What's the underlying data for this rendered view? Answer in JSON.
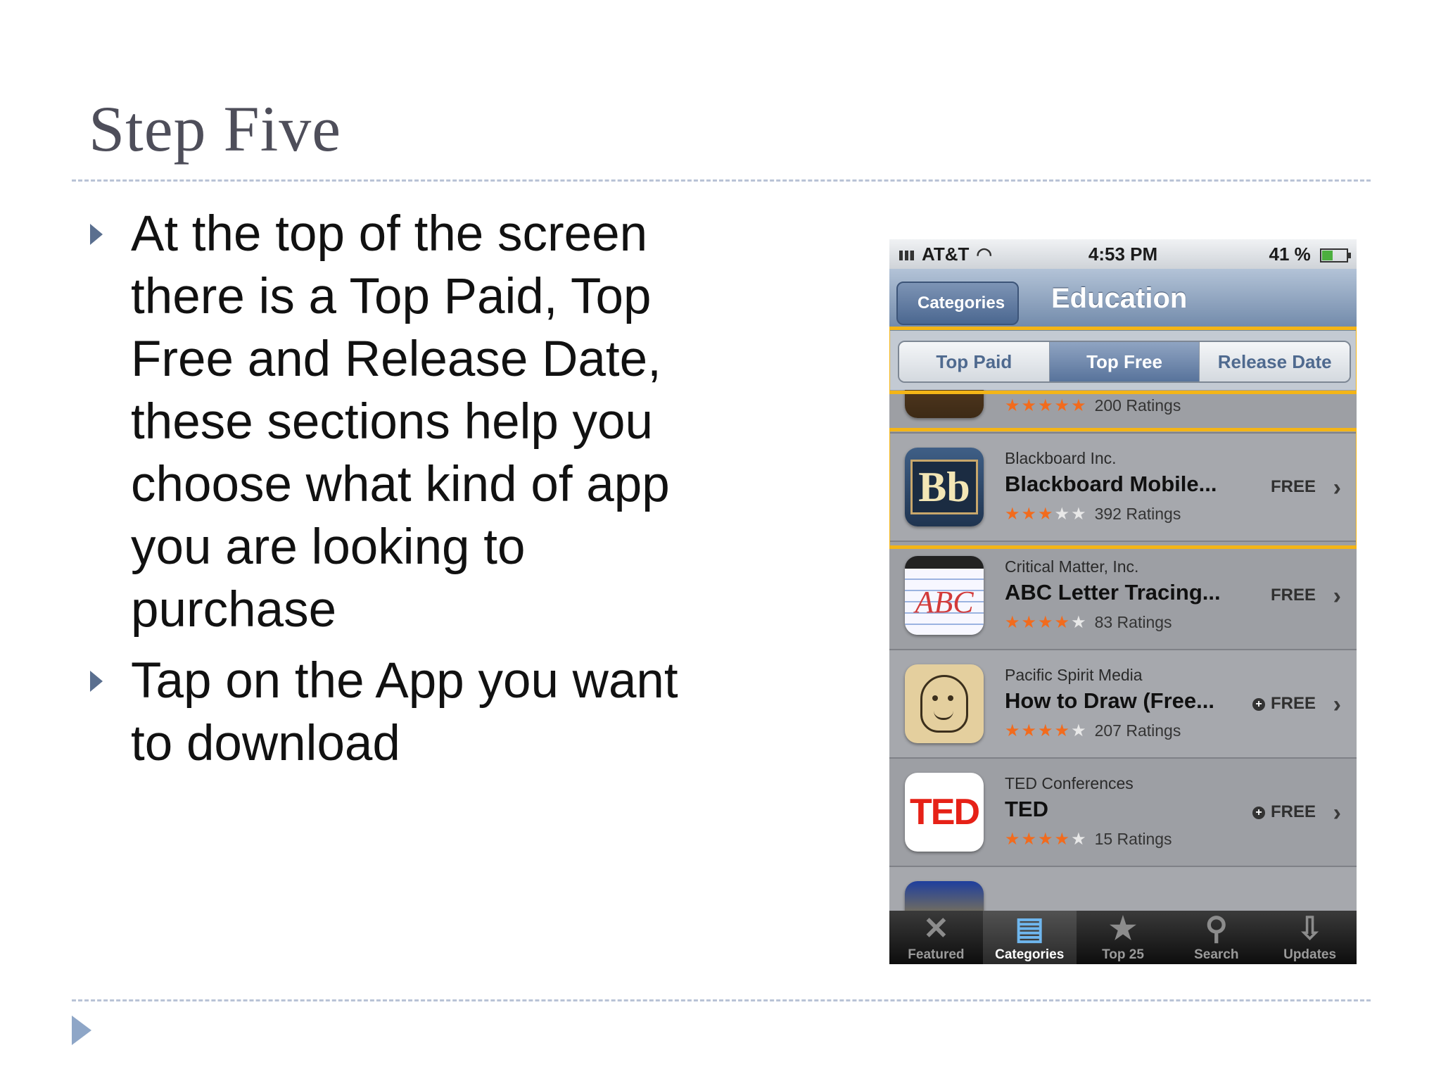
{
  "slide": {
    "title": "Step Five",
    "bullets": [
      "At the top of the screen there is a Top Paid, Top Free and Release Date, these sections help you choose what kind of app you are looking to purchase",
      "Tap on the App you want to download"
    ]
  },
  "phone": {
    "status": {
      "carrier": "AT&T",
      "time": "4:53 PM",
      "battery": "41 %",
      "battery_level": 0.41
    },
    "nav": {
      "back": "Categories",
      "title": "Education"
    },
    "segments": [
      {
        "label": "Top Paid",
        "selected": false
      },
      {
        "label": "Top Free",
        "selected": true
      },
      {
        "label": "Release Date",
        "selected": false
      }
    ],
    "partial_top": {
      "stars_on": 5,
      "ratings": "200 Ratings"
    },
    "apps": [
      {
        "publisher": "Blackboard Inc.",
        "name": "Blackboard Mobile...",
        "price": "FREE",
        "stars": 2.5,
        "ratings": "392 Ratings",
        "icon": "blackboard-icon",
        "icon_text": "Bb",
        "plus": false
      },
      {
        "publisher": "Critical Matter, Inc.",
        "name": "ABC Letter Tracing...",
        "price": "FREE",
        "stars": 3.5,
        "ratings": "83 Ratings",
        "icon": "abc-icon",
        "icon_text": "ABC",
        "plus": false
      },
      {
        "publisher": "Pacific Spirit Media",
        "name": "How to Draw (Free...",
        "price": "FREE",
        "stars": 4,
        "ratings": "207 Ratings",
        "icon": "face-drawing-icon",
        "icon_text": "",
        "plus": true
      },
      {
        "publisher": "TED Conferences",
        "name": "TED",
        "price": "FREE",
        "stars": 4,
        "ratings": "15 Ratings",
        "icon": "ted-icon",
        "icon_text": "TED",
        "plus": true
      }
    ],
    "tabs": [
      {
        "label": "Featured",
        "icon": "featured-icon",
        "glyph": "✕",
        "selected": false
      },
      {
        "label": "Categories",
        "icon": "categories-icon",
        "glyph": "▤",
        "selected": true
      },
      {
        "label": "Top 25",
        "icon": "star-icon",
        "glyph": "★",
        "selected": false
      },
      {
        "label": "Search",
        "icon": "search-icon",
        "glyph": "⚲",
        "selected": false
      },
      {
        "label": "Updates",
        "icon": "updates-icon",
        "glyph": "⇩",
        "selected": false
      }
    ],
    "colors": {
      "highlight": "#f4b516",
      "star_on": "#f26b1d",
      "nav": "#6e87a8"
    }
  }
}
